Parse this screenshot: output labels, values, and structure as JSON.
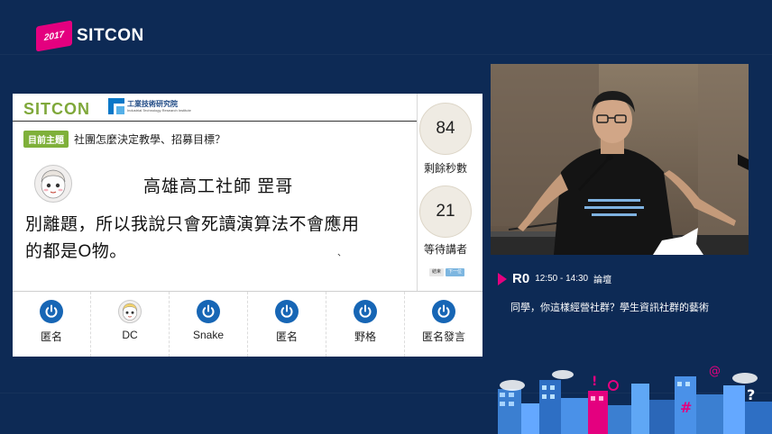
{
  "branding": {
    "year": "2017",
    "name": "SITCON",
    "panel_logo": "SITCON",
    "partner_name_cn": "工業技術研究院",
    "partner_name_en": "Industrial Technology Research Institute"
  },
  "topic": {
    "badge": "目前主題",
    "text": "社團怎麼決定教學、招募目標？"
  },
  "current_speaker": {
    "name": "高雄高工社師 罡哥",
    "avatar_icon": "doll-avatar-icon"
  },
  "message": {
    "line1": "別離題，所以我說只會死讀演算法不會應用",
    "line2": "的都是O物。",
    "stray_mark": "、"
  },
  "stats": {
    "seconds_left": "84",
    "seconds_left_label": "剩餘秒數",
    "waiting": "21",
    "waiting_label": "等待講者",
    "btn_a": "結束",
    "btn_b": "下一位"
  },
  "queue": [
    {
      "name": "匿名",
      "icon": "power-icon"
    },
    {
      "name": "DC",
      "icon": "doll-avatar-icon"
    },
    {
      "name": "Snake",
      "icon": "power-icon"
    },
    {
      "name": "匿名",
      "icon": "power-icon"
    },
    {
      "name": "野格",
      "icon": "power-icon"
    },
    {
      "name": "匿名發言",
      "icon": "power-icon"
    }
  ],
  "session": {
    "room": "R0",
    "time": "12:50 - 14:30",
    "type": "論壇",
    "title": "同學，你這樣經營社群？學生資訊社群的藝術"
  },
  "colors": {
    "background": "#0d2a55",
    "accent_magenta": "#e4007f",
    "sitcon_green": "#7fa83a",
    "queue_icon_blue": "#1766b5"
  }
}
